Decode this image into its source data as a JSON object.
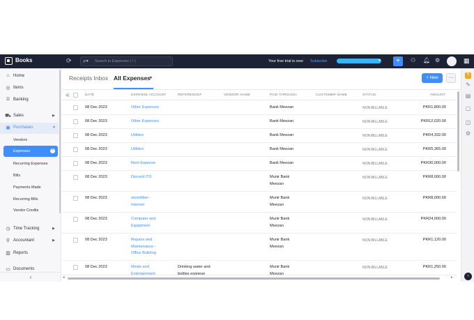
{
  "topbar": {
    "brand": "Books",
    "search_placeholder": "Search in Expenses ( / )",
    "trial_text": "Your free trial is over",
    "subscribe_label": "Subscribe",
    "new_label": "+",
    "icons": [
      "history-icon",
      "search-icon",
      "org-icon",
      "bell-icon",
      "gear-icon",
      "avatar",
      "apps-grid-icon"
    ]
  },
  "sidebar": {
    "items": [
      {
        "label": "Home",
        "icon": "home-icon"
      },
      {
        "label": "Items",
        "icon": "items-icon"
      },
      {
        "label": "Banking",
        "icon": "bank-icon"
      },
      {
        "label": "Sales",
        "icon": "cart-icon"
      },
      {
        "label": "Purchases",
        "icon": "bag-icon"
      },
      {
        "label": "Time Tracking",
        "icon": "clock-icon"
      },
      {
        "label": "Accountant",
        "icon": "person-icon"
      },
      {
        "label": "Reports",
        "icon": "chart-icon"
      },
      {
        "label": "Documents",
        "icon": "folder-icon"
      }
    ],
    "purchases_sub": [
      "Vendors",
      "Expenses",
      "Recurring Expenses",
      "Bills",
      "Payments Made",
      "Recurring Bills",
      "Vendor Credits"
    ],
    "collapse_glyph": "‹"
  },
  "main": {
    "tab_inbox": "Receipts Inbox",
    "tab_all": "All Expenses",
    "new_button": "+ New",
    "more_button": "···"
  },
  "table": {
    "headers": [
      "DATE",
      "EXPENSE ACCOUNT",
      "REFERENCE#",
      "VENDOR NAME",
      "PAID THROUGH",
      "CUSTOMER NAME",
      "STATUS",
      "AMOUNT"
    ],
    "rows": [
      {
        "date": "08 Dec 2023",
        "account": [
          "Other Expenses"
        ],
        "reference": [],
        "paid": [
          "Bank Meezan"
        ],
        "status": "NON-BILLABLE",
        "amount": "PKR1,800.00"
      },
      {
        "date": "08 Dec 2023",
        "account": [
          "Other Expenses"
        ],
        "reference": [],
        "paid": [
          "Bank Meezan"
        ],
        "status": "NON-BILLABLE",
        "amount": "PKR12,020.00"
      },
      {
        "date": "08 Dec 2023",
        "account": [
          "Utilities"
        ],
        "reference": [],
        "paid": [
          "Bank Meezan"
        ],
        "status": "NON-BILLABLE",
        "amount": "PKR4,332.00"
      },
      {
        "date": "08 Dec 2023",
        "account": [
          "Utilities"
        ],
        "reference": [],
        "paid": [
          "Bank Meezan"
        ],
        "status": "NON-BILLABLE",
        "amount": "PKR5,365.00"
      },
      {
        "date": "08 Dec 2023",
        "account": [
          "Rent Expense"
        ],
        "reference": [],
        "paid": [
          "Bank Meezan"
        ],
        "status": "NON-BILLABLE",
        "amount": "PKR30,000.00"
      },
      {
        "date": "08 Dec 2023",
        "account": [
          "Discord ITD"
        ],
        "reference": [],
        "paid": [
          "Munir Bank",
          "Meezan"
        ],
        "status": "NON-BILLABLE",
        "amount": "PKR8,000.00"
      },
      {
        "date": "08 Dec 2023",
        "account": [
          "stormfiber -",
          "Internet"
        ],
        "reference": [],
        "paid": [
          "Munir Bank",
          "Meezan"
        ],
        "status": "NON-BILLABLE",
        "amount": "PKR8,000.00"
      },
      {
        "date": "08 Dec 2023",
        "account": [
          "Computer and",
          "Equipment"
        ],
        "reference": [],
        "paid": [
          "Munir Bank",
          "Meezan"
        ],
        "status": "NON-BILLABLE",
        "amount": "PKR24,000.00"
      },
      {
        "date": "08 Dec 2023",
        "account": [
          "Repairs and",
          "Maintenance -",
          "Office Building"
        ],
        "reference": [],
        "paid": [
          "Munir Bank",
          "Meezan"
        ],
        "status": "NON-BILLABLE",
        "amount": "PKR1,120.00"
      },
      {
        "date": "08 Dec 2023",
        "account": [
          "Meals and",
          "Entertainment"
        ],
        "reference": [
          "Drinking water and",
          "bottles expnese"
        ],
        "paid": [
          "Munir Bank",
          "Meezan"
        ],
        "status": "NON-BILLABLE",
        "amount": "PKR1,250.00"
      }
    ]
  },
  "rail": {
    "badge": "?",
    "icons": [
      "help-icon",
      "announcement-icon",
      "document-icon",
      "feedback-icon",
      "image-icon",
      "settings-icon"
    ],
    "bottom": "›"
  },
  "colors": {
    "topbar": "#1e2235",
    "accent": "#408dfb",
    "sidebar_bg": "#f7f7fa"
  }
}
